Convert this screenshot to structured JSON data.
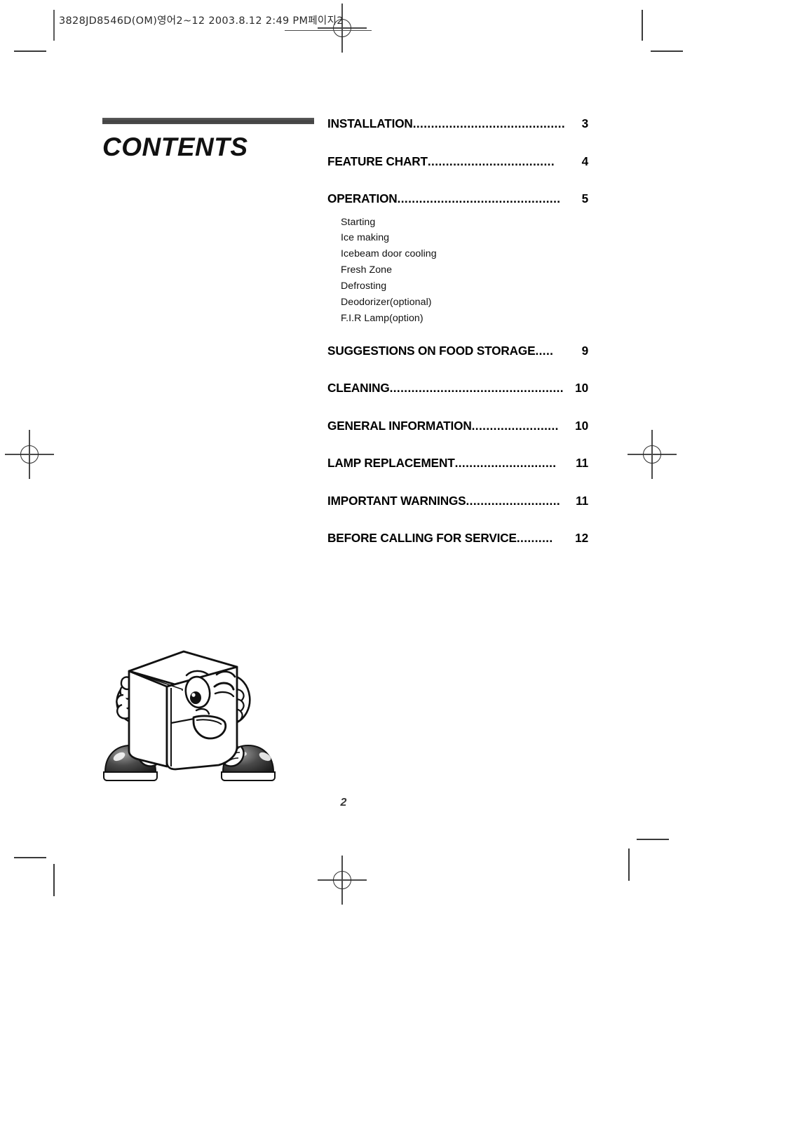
{
  "slug": {
    "text": "3828JD8546D(OM)영어2~12  2003.8.12 2:49 PM페이지2"
  },
  "heading": {
    "title": "CONTENTS"
  },
  "toc": {
    "entries": [
      {
        "label": "INSTALLATION",
        "leader": "..........................................",
        "page": "3"
      },
      {
        "label": "FEATURE CHART",
        "leader": "...................................",
        "page": "4"
      },
      {
        "label": "OPERATION",
        "leader": ".............................................",
        "page": "5"
      },
      {
        "label": "SUGGESTIONS ON FOOD STORAGE",
        "leader": ".....",
        "page": "9"
      },
      {
        "label": "CLEANING",
        "leader": "................................................",
        "page": "10"
      },
      {
        "label": "GENERAL INFORMATION",
        "leader": "........................",
        "page": "10"
      },
      {
        "label": "LAMP REPLACEMENT",
        "leader": "............................",
        "page": "11"
      },
      {
        "label": "IMPORTANT WARNINGS",
        "leader": "..........................",
        "page": "11"
      },
      {
        "label": "BEFORE CALLING FOR SERVICE",
        "leader": "..........",
        "page": "12"
      }
    ],
    "operation_subitems": [
      "Starting",
      "Ice making",
      "Icebeam door cooling",
      "Fresh Zone",
      "Defrosting",
      "Deodorizer(optional)",
      "F.I.R Lamp(option)"
    ]
  },
  "footer": {
    "page_number": "2"
  },
  "illustration": {
    "name": "refrigerator-mascot-character"
  },
  "colors": {
    "bar": "#4a4a4a",
    "text": "#000000",
    "crop_mark": "#3a3a3a",
    "slug_text": "#2b2b2b"
  }
}
